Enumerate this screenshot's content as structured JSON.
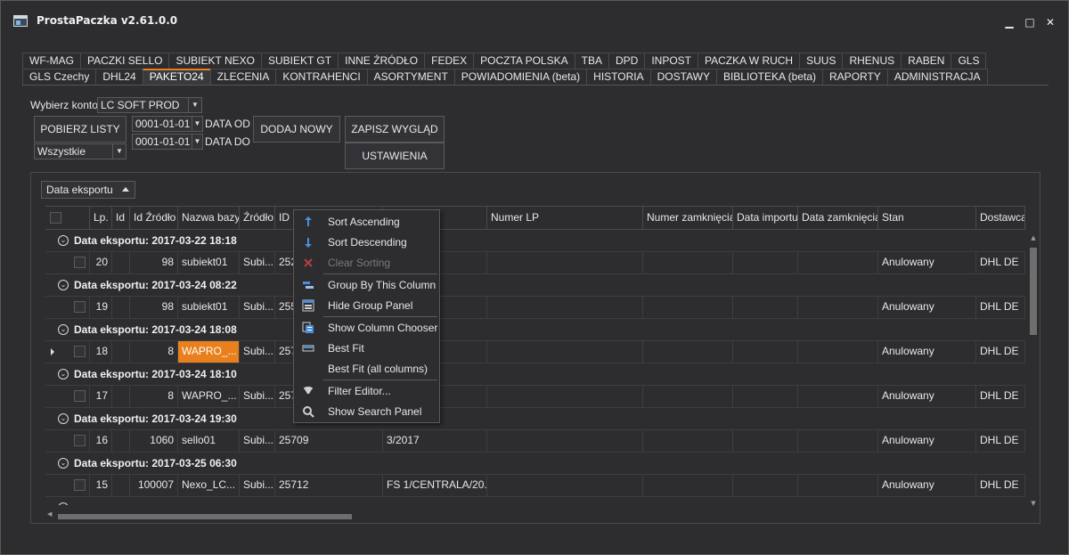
{
  "window": {
    "title": "ProstaPaczka v2.61.0.0",
    "controls": {
      "minimize": "▁",
      "maximize": "□",
      "close": "✕"
    }
  },
  "tabs_row1": [
    "WF-MAG",
    "PACZKI SELLO",
    "SUBIEKT NEXO",
    "SUBIEKT GT",
    "INNE ŹRÓDŁO",
    "FEDEX",
    "POCZTA POLSKA",
    "TBA",
    "DPD",
    "INPOST",
    "PACZKA W RUCH",
    "SUUS",
    "RHENUS",
    "RABEN",
    "GLS"
  ],
  "tabs_row2": [
    "GLS Czechy",
    "DHL24",
    "PAKETO24",
    "ZLECENIA",
    "KONTRAHENCI",
    "ASORTYMENT",
    "POWIADOMIENIA (beta)",
    "HISTORIA",
    "DOSTAWY",
    "BIBLIOTEKA (beta)",
    "RAPORTY",
    "ADMINISTRACJA"
  ],
  "active_tab": "PAKETO24",
  "toolbar": {
    "account_label": "Wybierz konto:",
    "account_value": "LC SOFT  PROD",
    "fetch_button": "POBIERZ LISTY",
    "filter_value": "Wszystkie",
    "date_from_value": "0001-01-01",
    "date_from_label": "DATA OD",
    "date_to_value": "0001-01-01",
    "date_to_label": "DATA DO",
    "add_new_button": "DODAJ NOWY",
    "save_layout_button": "ZAPISZ WYGLĄD",
    "settings_button": "USTAWIENIA"
  },
  "grid": {
    "group_chip": "Data eksportu",
    "columns": {
      "lp": "Lp.",
      "id": "Id",
      "id_zrodlo": "Id Źródło",
      "nazwa_bazy": "Nazwa bazy",
      "zrodlo": "Źródło",
      "id_c": "ID C",
      "numer_lp": "Numer LP",
      "numer_zamkniecia": "Numer zamknięcia",
      "data_importu": "Data importu",
      "data_zamkniecia": "Data zamknięcia",
      "stan": "Stan",
      "dostawca": "Dostawca"
    },
    "groups": [
      {
        "label": "Data eksportu: 2017-03-22 18:18",
        "row": {
          "lp": "20",
          "id_zrodlo": "98",
          "nazwa_bazy": "subiekt01",
          "zrodlo": "Subi...",
          "id_c": "252",
          "doc": "/2017",
          "stan": "Anulowany",
          "dostawca": "DHL DE"
        }
      },
      {
        "label": "Data eksportu: 2017-03-24 08:22",
        "row": {
          "lp": "19",
          "id_zrodlo": "98",
          "nazwa_bazy": "subiekt01",
          "zrodlo": "Subi...",
          "id_c": "255",
          "doc": "/2017",
          "stan": "Anulowany",
          "dostawca": "DHL DE"
        }
      },
      {
        "label": "Data eksportu: 2017-03-24 18:08",
        "row": {
          "lp": "18",
          "id_zrodlo": "8",
          "nazwa_bazy": "WAPRO_...",
          "zrodlo": "Subi...",
          "id_c": "257",
          "doc": "",
          "stan": "Anulowany",
          "dostawca": "DHL DE"
        }
      },
      {
        "label": "Data eksportu: 2017-03-24 18:10",
        "row": {
          "lp": "17",
          "id_zrodlo": "8",
          "nazwa_bazy": "WAPRO_...",
          "zrodlo": "Subi...",
          "id_c": "257",
          "doc": "",
          "stan": "Anulowany",
          "dostawca": "DHL DE"
        }
      },
      {
        "label": "Data eksportu: 2017-03-24 19:30",
        "row": {
          "lp": "16",
          "id_zrodlo": "1060",
          "nazwa_bazy": "sello01",
          "zrodlo": "Subi...",
          "id_c": "25709",
          "doc": "3/2017",
          "stan": "Anulowany",
          "dostawca": "DHL DE"
        }
      },
      {
        "label": "Data eksportu: 2017-03-25 06:30",
        "row": {
          "lp": "15",
          "id_zrodlo": "100007",
          "nazwa_bazy": "Nexo_LC...",
          "zrodlo": "Subi...",
          "id_c": "25712",
          "doc": "FS 1/CENTRALA/20...",
          "stan": "Anulowany",
          "dostawca": "DHL DE"
        }
      }
    ]
  },
  "context_menu": {
    "sort_asc": "Sort Ascending",
    "sort_desc": "Sort Descending",
    "clear_sort": "Clear Sorting",
    "group_by": "Group By This Column",
    "hide_group_panel": "Hide Group Panel",
    "show_column_chooser": "Show Column Chooser",
    "best_fit": "Best Fit",
    "best_fit_all": "Best Fit (all columns)",
    "filter_editor": "Filter Editor...",
    "show_search_panel": "Show Search Panel"
  },
  "colors": {
    "accent": "#e8801d",
    "background": "#2d2d30"
  }
}
